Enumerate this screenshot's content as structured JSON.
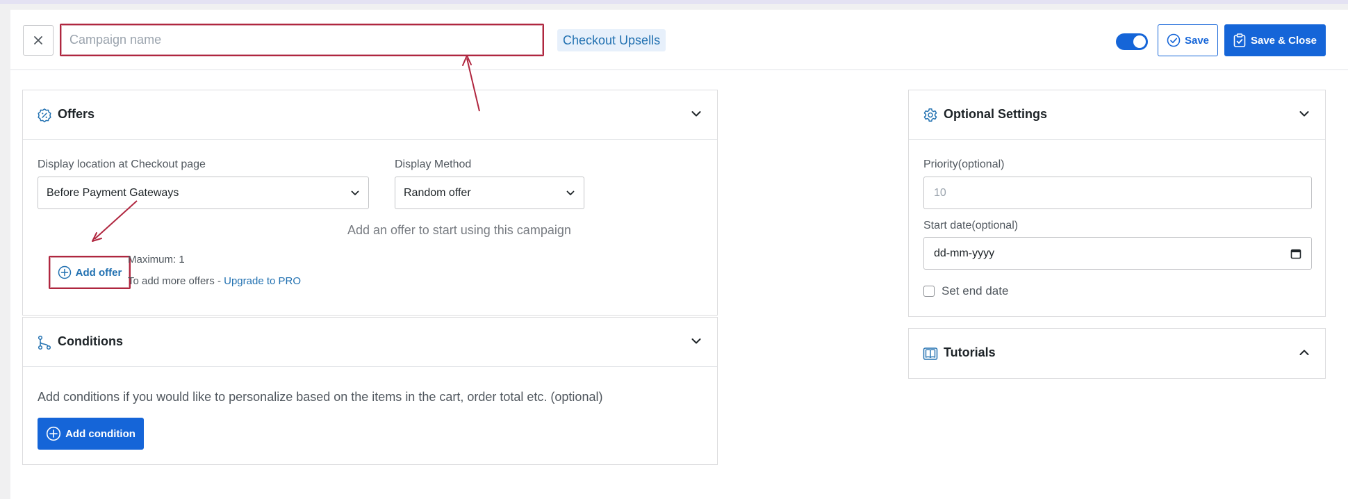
{
  "header": {
    "close_icon": "close-icon",
    "campaign_name_value": "",
    "campaign_name_placeholder": "Campaign name",
    "campaign_type": "Checkout Upsells",
    "active_toggle_on": true,
    "save_label": "Save",
    "save_close_label": "Save & Close"
  },
  "offers": {
    "title": "Offers",
    "icon": "badge-percent-icon",
    "display_location_label": "Display location at Checkout page",
    "display_location_value": "Before Payment Gateways",
    "display_method_label": "Display Method",
    "display_method_value": "Random offer",
    "empty_message": "Add an offer to start using this campaign",
    "add_offer_label": "Add offer",
    "maximum_text": "Maximum: 1",
    "more_offers_text": "To add more offers - ",
    "upgrade_link": "Upgrade to PRO"
  },
  "conditions": {
    "title": "Conditions",
    "icon": "git-branch-icon",
    "description": "Add conditions if you would like to personalize based on the items in the cart, order total etc. (optional)",
    "add_condition_label": "Add condition"
  },
  "optional_settings": {
    "title": "Optional Settings",
    "icon": "gear-icon",
    "priority_label": "Priority",
    "priority_suffix": "(optional)",
    "priority_placeholder": "10",
    "start_date_label": "Start date",
    "start_date_suffix": "(optional)",
    "start_date_value": "dd-mm-yyyy",
    "set_end_date_label": "Set end date",
    "set_end_date_checked": false
  },
  "tutorials": {
    "title": "Tutorials",
    "icon": "book-icon"
  },
  "colors": {
    "accent": "#1565d8",
    "link": "#2271b1",
    "annotation": "#b0263f"
  }
}
